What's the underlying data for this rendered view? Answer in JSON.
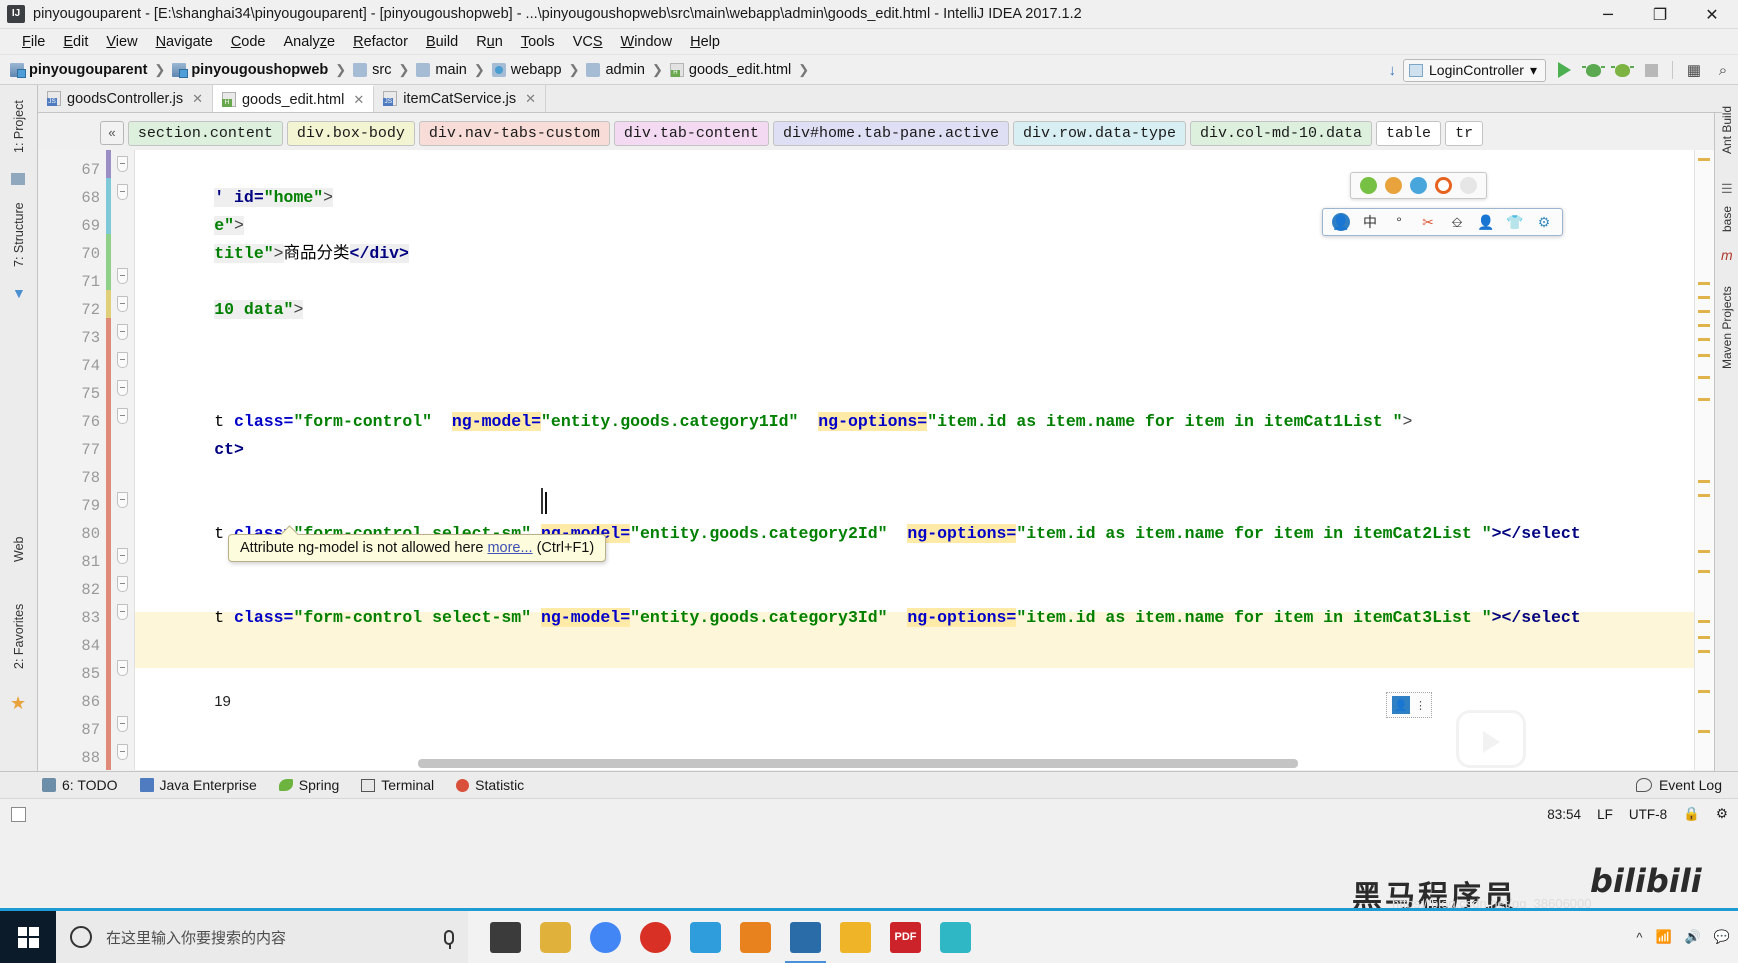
{
  "window": {
    "title": "pinyougouparent - [E:\\shanghai34\\pinyougouparent] - [pinyougoushopweb] - ...\\pinyougoushopweb\\src\\main\\webapp\\admin\\goods_edit.html - IntelliJ IDEA 2017.1.2",
    "app_icon": "IJ",
    "minimize": "─",
    "maximize": "❐",
    "close": "✕"
  },
  "menubar": {
    "items": [
      "File",
      "Edit",
      "View",
      "Navigate",
      "Code",
      "Analyze",
      "Refactor",
      "Build",
      "Run",
      "Tools",
      "VCS",
      "Window",
      "Help"
    ]
  },
  "navbar": {
    "breadcrumbs": [
      {
        "label": "pinyougouparent",
        "icon": "module-icon",
        "bold": true
      },
      {
        "label": "pinyougoushopweb",
        "icon": "module-icon",
        "bold": true
      },
      {
        "label": "src",
        "icon": "folder-icon",
        "bold": false
      },
      {
        "label": "main",
        "icon": "folder-icon",
        "bold": false
      },
      {
        "label": "webapp",
        "icon": "webfolder-icon",
        "bold": false
      },
      {
        "label": "admin",
        "icon": "folder-icon",
        "bold": false
      },
      {
        "label": "goods_edit.html",
        "icon": "html-file-icon",
        "bold": false
      }
    ],
    "run_config": "LoginController",
    "run_config_caret": "▾",
    "update_icon": "↓",
    "search_icon": "⌕"
  },
  "editor_tabs": [
    {
      "label": "goodsController.js",
      "type": "js",
      "active": false,
      "close": "✕"
    },
    {
      "label": "goods_edit.html",
      "type": "html",
      "active": true,
      "close": "✕"
    },
    {
      "label": "itemCatService.js",
      "type": "js",
      "active": false,
      "close": "✕"
    }
  ],
  "left_tool_strip": [
    {
      "label": "1: Project"
    },
    {
      "label": "7: Structure"
    },
    {
      "label": "Web"
    },
    {
      "label": "2: Favorites"
    }
  ],
  "right_tool_strip": [
    {
      "label": "Ant Build"
    },
    {
      "label": "base"
    },
    {
      "label": "Maven Projects"
    }
  ],
  "element_breadcrumb": {
    "collapse_label": "«",
    "items": [
      {
        "label": "section.content",
        "color": "#ddf0dd"
      },
      {
        "label": "div.box-body",
        "color": "#f2f4d2"
      },
      {
        "label": "div.nav-tabs-custom",
        "color": "#f8dcd8"
      },
      {
        "label": "div.tab-content",
        "color": "#f3daf2"
      },
      {
        "label": "div#home.tab-pane.active",
        "color": "#dedef4"
      },
      {
        "label": "div.row.data-type",
        "color": "#d7eef2"
      },
      {
        "label": "div.col-md-10.data",
        "color": "#ddf0dd"
      },
      {
        "label": "table",
        "color": "#ffffff"
      },
      {
        "label": "tr",
        "color": "#ffffff"
      }
    ]
  },
  "editor": {
    "line_numbers": [
      67,
      68,
      69,
      70,
      71,
      72,
      73,
      74,
      75,
      76,
      77,
      78,
      79,
      80,
      81,
      82,
      83,
      84,
      85,
      86,
      87,
      88
    ],
    "lines": [
      {
        "num": 67,
        "segments": [
          {
            "t": "' id=",
            "c": "tag"
          },
          {
            "t": "\"home\"",
            "c": "val"
          },
          {
            "t": ">",
            "c": "punct"
          }
        ]
      },
      {
        "num": 68,
        "segments": [
          {
            "t": "e\"",
            "c": "val"
          },
          {
            "t": ">",
            "c": "punct"
          }
        ]
      },
      {
        "num": 69,
        "segments": [
          {
            "t": "title\"",
            "c": "val"
          },
          {
            "t": ">",
            "c": "punct"
          },
          {
            "t": "商品分类",
            "c": "plain"
          },
          {
            "t": "</div>",
            "c": "tag"
          }
        ]
      },
      {
        "num": 70,
        "segments": []
      },
      {
        "num": 71,
        "segments": [
          {
            "t": "10 data\"",
            "c": "val"
          },
          {
            "t": ">",
            "c": "punct"
          }
        ]
      },
      {
        "num": 72,
        "segments": []
      },
      {
        "num": 73,
        "segments": []
      },
      {
        "num": 74,
        "segments": []
      },
      {
        "num": 75,
        "segments": [
          {
            "t": "t ",
            "c": "plain"
          },
          {
            "t": "class=",
            "c": "attr"
          },
          {
            "t": "\"form-control\"",
            "c": "val"
          },
          {
            "t": "  ",
            "c": "plain"
          },
          {
            "t": "ng-model=",
            "c": "attr"
          },
          {
            "t": "\"entity.goods.category1Id\"",
            "c": "val"
          },
          {
            "t": "  ",
            "c": "plain"
          },
          {
            "t": "ng-options=",
            "c": "attr"
          },
          {
            "t": "\"item.id as item.name for item in itemCat1List \"",
            "c": "val"
          },
          {
            "t": ">",
            "c": "punct"
          }
        ]
      },
      {
        "num": 76,
        "segments": [
          {
            "t": "ct>",
            "c": "tag"
          }
        ]
      },
      {
        "num": 77,
        "segments": []
      },
      {
        "num": 78,
        "segments": []
      },
      {
        "num": 79,
        "segments": [
          {
            "t": "t ",
            "c": "plain"
          },
          {
            "t": "class=",
            "c": "attr"
          },
          {
            "t": "\"form-control select-sm\"",
            "c": "val"
          },
          {
            "t": " ",
            "c": "plain"
          },
          {
            "t": "ng-model=",
            "c": "attr"
          },
          {
            "t": "\"entity.goods.category2Id\"",
            "c": "val"
          },
          {
            "t": "  ",
            "c": "plain"
          },
          {
            "t": "ng-options=",
            "c": "attr"
          },
          {
            "t": "\"item.id as item.name for item in itemCat2List \"",
            "c": "val"
          },
          {
            "t": "></select",
            "c": "tag"
          }
        ]
      },
      {
        "num": 80,
        "segments": []
      },
      {
        "num": 81,
        "segments": []
      },
      {
        "num": 82,
        "segments": [
          {
            "t": "t ",
            "c": "plain"
          },
          {
            "t": "class=",
            "c": "attr"
          },
          {
            "t": "\"form-control select-sm\"",
            "c": "val"
          },
          {
            "t": " ",
            "c": "plain"
          },
          {
            "t": "ng-model=",
            "c": "attr"
          },
          {
            "t": "\"entity.goods.category3Id\"",
            "c": "val"
          },
          {
            "t": "  ",
            "c": "plain"
          },
          {
            "t": "ng-options=",
            "c": "attr"
          },
          {
            "t": "\"item.id as item.name for item in itemCat3List \"",
            "c": "val"
          },
          {
            "t": "></select",
            "c": "tag"
          }
        ]
      },
      {
        "num": 83,
        "segments": []
      },
      {
        "num": 84,
        "segments": []
      },
      {
        "num": 85,
        "segments": [
          {
            "t": "19",
            "c": "plain"
          }
        ]
      },
      {
        "num": 86,
        "segments": []
      },
      {
        "num": 87,
        "segments": []
      },
      {
        "num": 88,
        "segments": []
      }
    ],
    "tooltip": {
      "text_before": "Attribute ng-model is not allowed here ",
      "link": "more...",
      "text_after": " (Ctrl+F1)"
    }
  },
  "bottom_bar": {
    "items": [
      {
        "label": "6: TODO",
        "icon": "todo-icon"
      },
      {
        "label": "Java Enterprise",
        "icon": "java-ee-icon"
      },
      {
        "label": "Spring",
        "icon": "spring-leaf-icon"
      },
      {
        "label": "Terminal",
        "icon": "terminal-icon"
      },
      {
        "label": "Statistic",
        "icon": "statistic-icon"
      }
    ],
    "event_log": "Event Log",
    "event_log_icon": "balloon-icon"
  },
  "status_bar": {
    "caret_position": "83:54",
    "line_separator": "LF",
    "encoding": "UTF-8",
    "lock_icon": "lock-icon",
    "hector_icon": "inspection-icon"
  },
  "watermarks": {
    "heima": "黑马程序员",
    "bilibili": "bilibili",
    "url": "https://blog.csdn.net/qq_38606000"
  },
  "taskbar": {
    "search_placeholder": "在这里输入你要搜索的内容",
    "start_icon": "windows-logo-icon",
    "cortana_icon": "cortana-circle-icon",
    "mic_icon": "microphone-icon",
    "apps": [
      {
        "name": "task-view",
        "color": "#3b3b3b"
      },
      {
        "name": "app-icon-colorful",
        "color": "#e0b23c"
      },
      {
        "name": "chrome",
        "color": "#4285f4"
      },
      {
        "name": "red-app",
        "color": "#d93025"
      },
      {
        "name": "blue-app",
        "color": "#2f9ddb"
      },
      {
        "name": "orange-app",
        "color": "#e8821e"
      },
      {
        "name": "intellij-idea",
        "color": "#2a6ca8"
      },
      {
        "name": "file-explorer",
        "color": "#f0b429"
      },
      {
        "name": "pdf-reader",
        "color": "#cc2229"
      },
      {
        "name": "teal-app",
        "color": "#2fb7c5"
      }
    ],
    "tray_time": ""
  },
  "colors": {
    "accent": "#1f9bd4",
    "attr": "#0000c8",
    "value": "#008000",
    "tag": "#000080",
    "highlight": "#ffeaa7",
    "tooltip_bg": "#fdfcdc"
  }
}
